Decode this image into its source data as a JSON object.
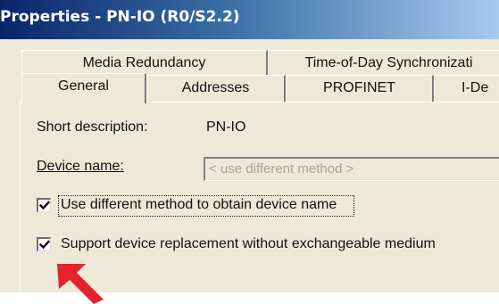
{
  "window": {
    "title": "Properties - PN-IO (R0/S2.2)"
  },
  "tabs": {
    "row1": [
      "Media Redundancy",
      "Time-of-Day Synchronizati"
    ],
    "row2": [
      "General",
      "Addresses",
      "PROFINET",
      "I-De"
    ],
    "selected": "General"
  },
  "general": {
    "short_description_label": "Short description:",
    "short_description_value": "PN-IO",
    "device_name_label": "Device name:",
    "device_name_placeholder": "< use different method >",
    "use_different_method_label": "Use different method to obtain device name",
    "use_different_method_checked": true,
    "support_replacement_label": "Support device replacement without exchangeable medium",
    "support_replacement_checked": true
  },
  "annotation": {
    "arrow_icon": "red-arrow-icon",
    "arrow_color": "#e3242b"
  },
  "colors": {
    "title_bar_start": "#0a246a",
    "title_bar_end": "#a6caf0",
    "dialog_background": "#ece9d8"
  }
}
